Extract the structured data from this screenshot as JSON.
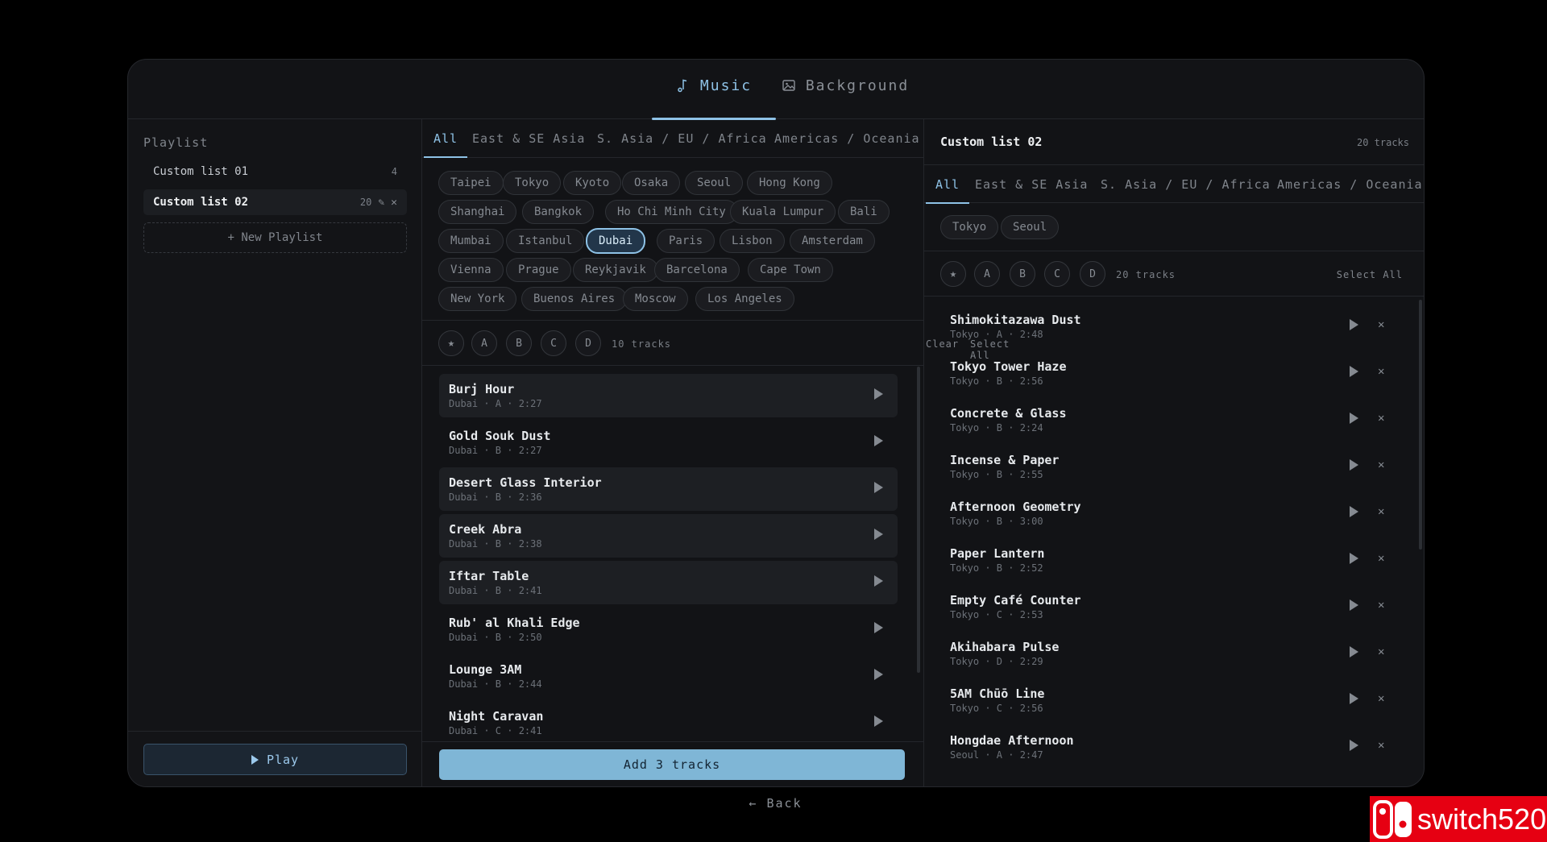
{
  "top_tabs": {
    "music": "Music",
    "background": "Background"
  },
  "sidebar": {
    "heading": "Playlist",
    "playlists": [
      {
        "name": "Custom list 01",
        "count": "4"
      },
      {
        "name": "Custom list 02",
        "count": "20"
      }
    ],
    "new_playlist": "+ New Playlist",
    "play_label": "Play"
  },
  "region_tabs": [
    "All",
    "East & SE Asia",
    "S. Asia / EU / Africa",
    "Americas / Oceania"
  ],
  "cities": [
    "Taipei",
    "Tokyo",
    "Kyoto",
    "Osaka",
    "Seoul",
    "Hong Kong",
    "Shanghai",
    "Bangkok",
    "Ho Chi Minh City",
    "Kuala Lumpur",
    "Bali",
    "Mumbai",
    "Istanbul",
    "Dubai",
    "Paris",
    "Lisbon",
    "Amsterdam",
    "Vienna",
    "Prague",
    "Reykjavik",
    "Barcelona",
    "Cape Town",
    "New York",
    "Buenos Aires",
    "Moscow",
    "Los Angeles"
  ],
  "selected_city": "Dubai",
  "filters": [
    "A",
    "B",
    "C",
    "D"
  ],
  "middle": {
    "track_count": "10 tracks",
    "clear": "Clear",
    "select_all": "Select All",
    "add_button": "Add 3 tracks",
    "tracks": [
      {
        "title": "Burj Hour",
        "meta": "Dubai · A · 2:27",
        "selected": true
      },
      {
        "title": "Gold Souk Dust",
        "meta": "Dubai · B · 2:27",
        "selected": false
      },
      {
        "title": "Desert Glass Interior",
        "meta": "Dubai · B · 2:36",
        "selected": true
      },
      {
        "title": "Creek Abra",
        "meta": "Dubai · B · 2:38",
        "selected": true
      },
      {
        "title": "Iftar Table",
        "meta": "Dubai · B · 2:41",
        "selected": true
      },
      {
        "title": "Rub' al Khali Edge",
        "meta": "Dubai · B · 2:50",
        "selected": false
      },
      {
        "title": "Lounge 3AM",
        "meta": "Dubai · B · 2:44",
        "selected": false
      },
      {
        "title": "Night Caravan",
        "meta": "Dubai · C · 2:41",
        "selected": false
      }
    ]
  },
  "right": {
    "title": "Custom list 02",
    "count": "20 tracks",
    "city_chips": [
      "Tokyo",
      "Seoul"
    ],
    "track_count": "20 tracks",
    "select_all": "Select All",
    "tracks": [
      {
        "title": "Shimokitazawa Dust",
        "meta": "Tokyo · A · 2:48"
      },
      {
        "title": "Tokyo Tower Haze",
        "meta": "Tokyo · B · 2:56"
      },
      {
        "title": "Concrete & Glass",
        "meta": "Tokyo · B · 2:24"
      },
      {
        "title": "Incense & Paper",
        "meta": "Tokyo · B · 2:55"
      },
      {
        "title": "Afternoon Geometry",
        "meta": "Tokyo · B · 3:00"
      },
      {
        "title": "Paper Lantern",
        "meta": "Tokyo · B · 2:52"
      },
      {
        "title": "Empty Café Counter",
        "meta": "Tokyo · C · 2:53"
      },
      {
        "title": "Akihabara Pulse",
        "meta": "Tokyo · D · 2:29"
      },
      {
        "title": "5AM Chūō Line",
        "meta": "Tokyo · C · 2:56"
      },
      {
        "title": "Hongdae Afternoon",
        "meta": "Seoul · A · 2:47"
      }
    ]
  },
  "back_label": "← Back",
  "watermark": "switch520",
  "colors": {
    "accent": "#8ec2e6",
    "add_button": "#7fb6d6",
    "logo": "#e60012"
  }
}
